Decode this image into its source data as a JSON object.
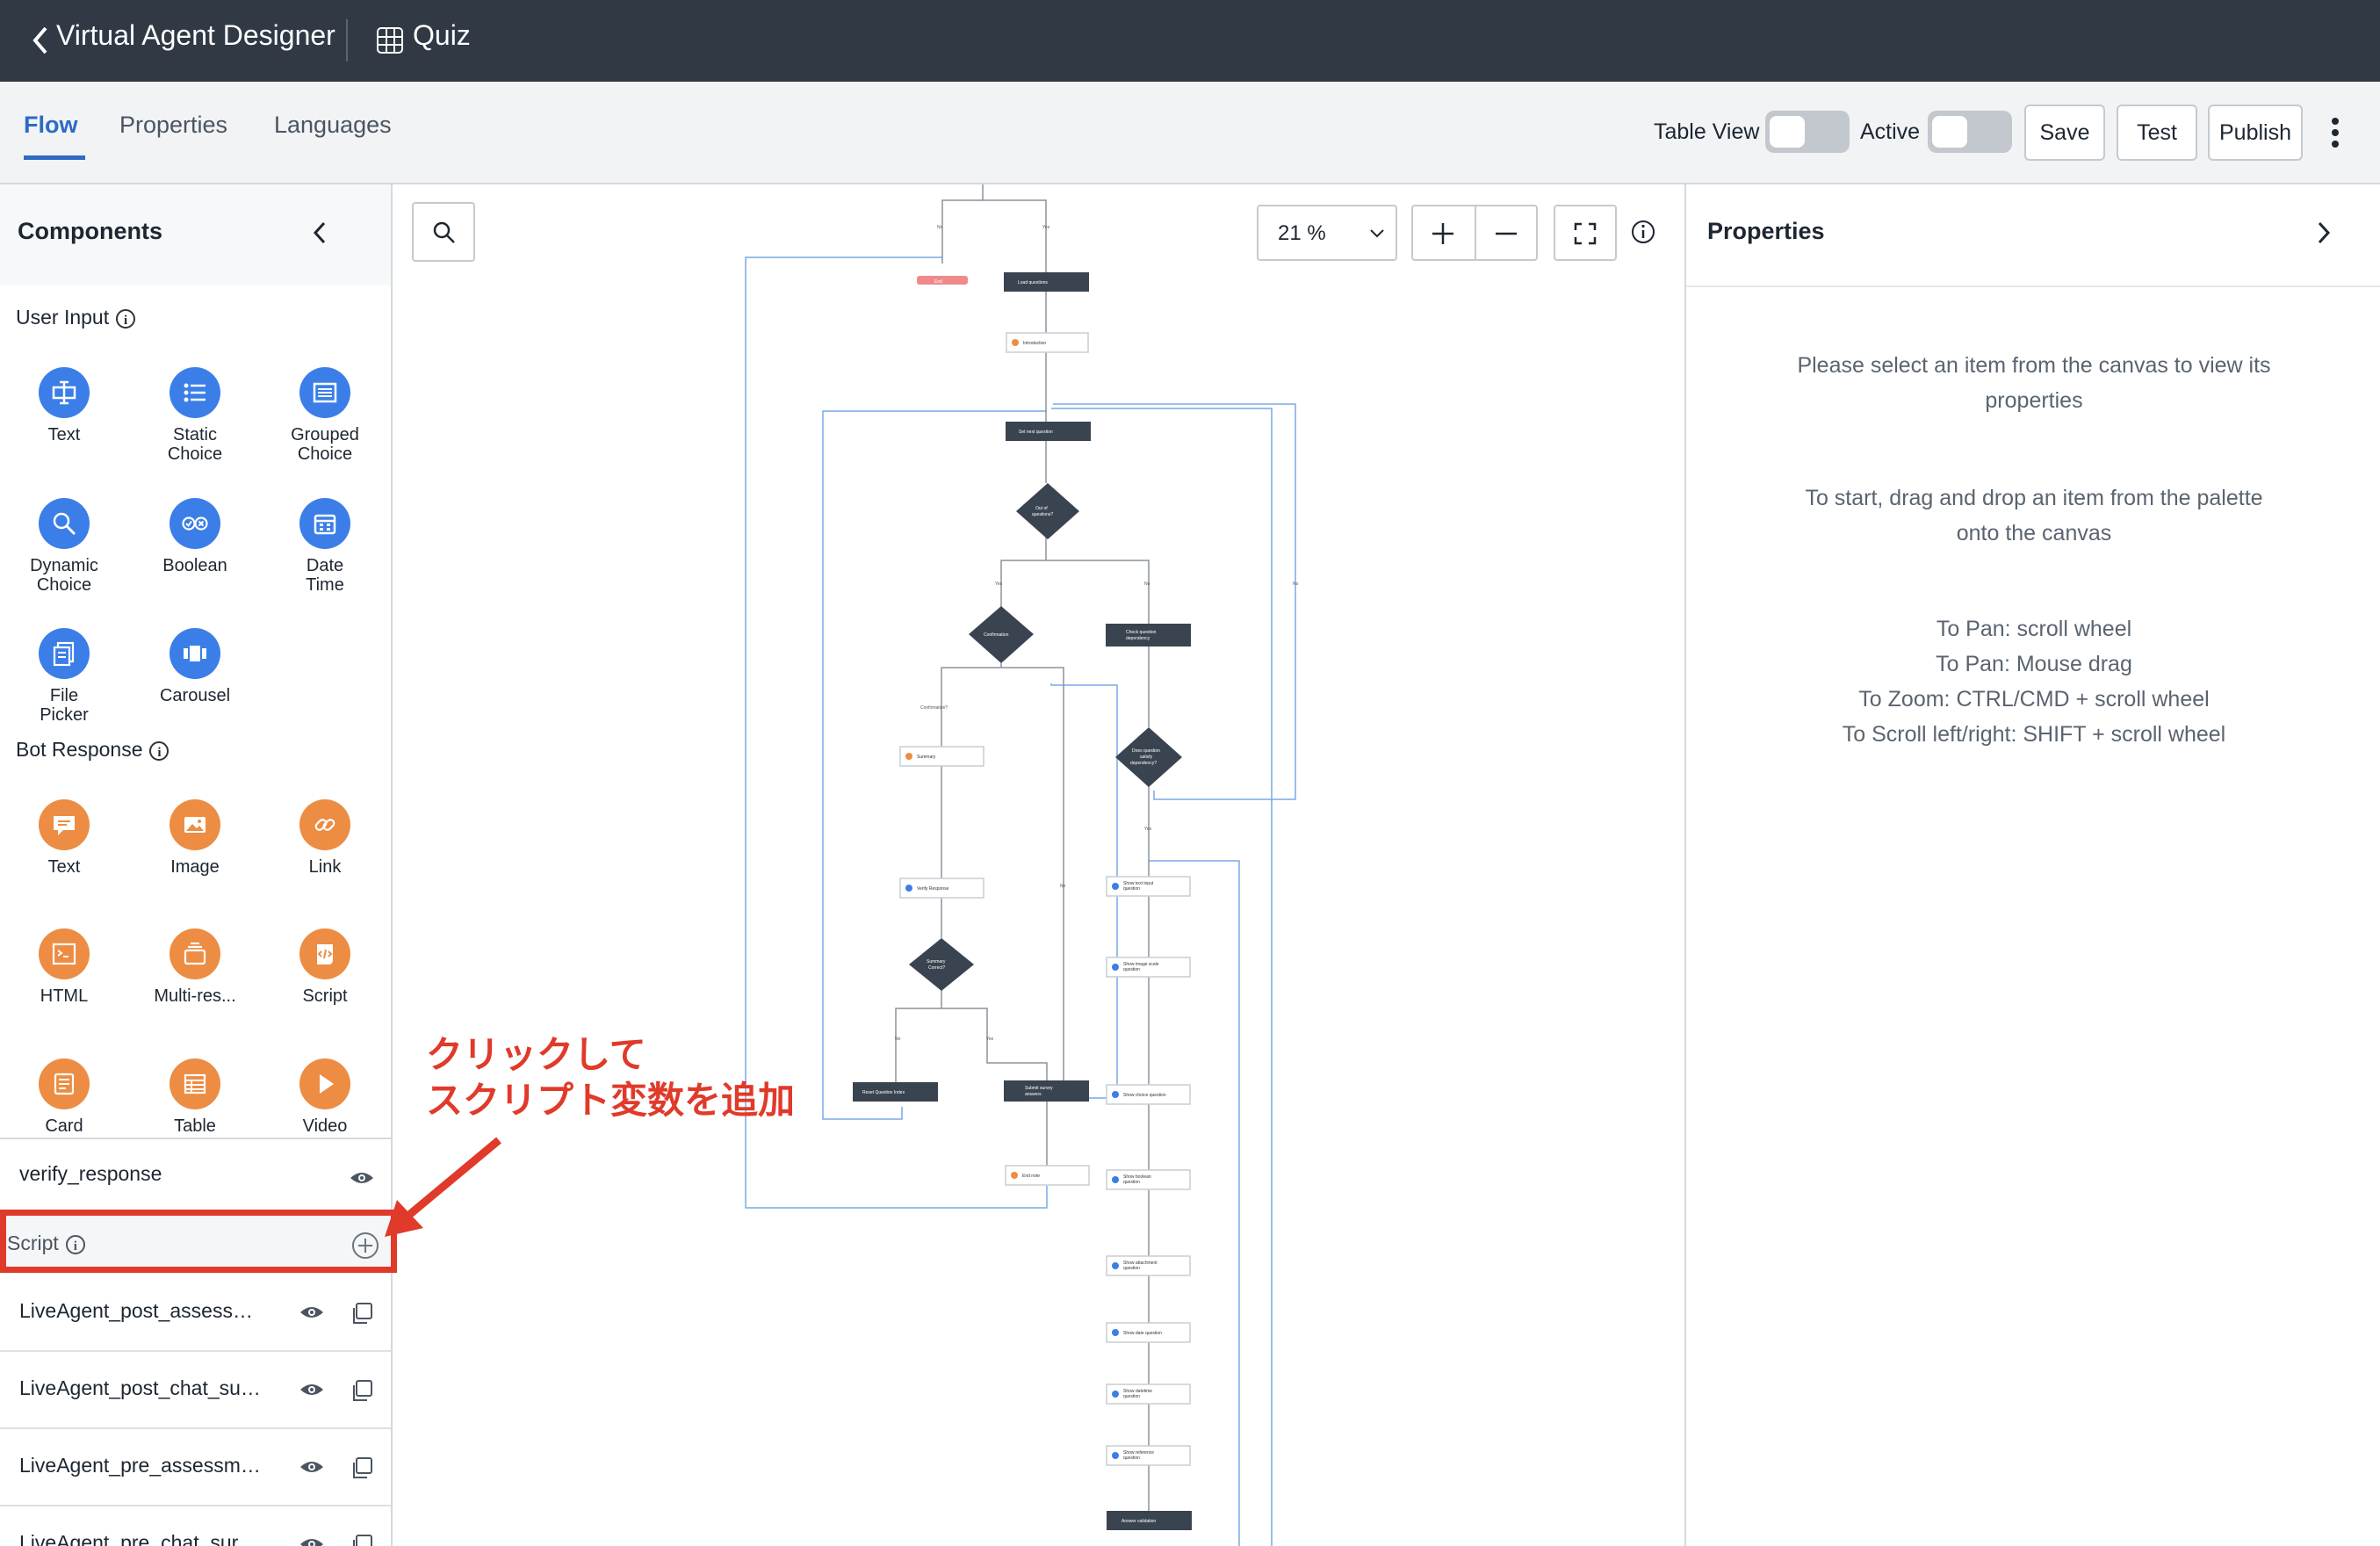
{
  "header": {
    "back_title": "Virtual Agent Designer",
    "topic": "Quiz"
  },
  "tabs": [
    {
      "label": "Flow",
      "active": true
    },
    {
      "label": "Properties",
      "active": false
    },
    {
      "label": "Languages",
      "active": false
    }
  ],
  "toolbar": {
    "table_view_label": "Table View",
    "table_view_on": false,
    "active_label": "Active",
    "active_on": false,
    "save_label": "Save",
    "test_label": "Test",
    "publish_label": "Publish"
  },
  "components": {
    "title": "Components",
    "user_input_label": "User Input",
    "bot_response_label": "Bot Response",
    "user_input": [
      {
        "line1": "Text",
        "line2": "",
        "icon": "text-input-icon"
      },
      {
        "line1": "Static",
        "line2": "Choice",
        "icon": "list-icon"
      },
      {
        "line1": "Grouped",
        "line2": "Choice",
        "icon": "grouped-list-icon"
      },
      {
        "line1": "Dynamic",
        "line2": "Choice",
        "icon": "search-icon"
      },
      {
        "line1": "Boolean",
        "line2": "",
        "icon": "boolean-icon"
      },
      {
        "line1": "Date",
        "line2": "Time",
        "icon": "calendar-icon"
      },
      {
        "line1": "File",
        "line2": "Picker",
        "icon": "file-icon"
      },
      {
        "line1": "Carousel",
        "line2": "",
        "icon": "carousel-icon"
      }
    ],
    "bot_response": [
      {
        "line1": "Text",
        "icon": "message-icon"
      },
      {
        "line1": "Image",
        "icon": "image-icon"
      },
      {
        "line1": "Link",
        "icon": "link-icon"
      },
      {
        "line1": "HTML",
        "icon": "html-icon"
      },
      {
        "line1": "Multi-res...",
        "icon": "multi-response-icon"
      },
      {
        "line1": "Script",
        "icon": "script-icon"
      },
      {
        "line1": "Card",
        "icon": "card-icon"
      },
      {
        "line1": "Table",
        "icon": "table-icon"
      },
      {
        "line1": "Video",
        "icon": "play-icon"
      }
    ]
  },
  "variables": {
    "top_item": "verify_response",
    "script_section_label": "Script",
    "script_items": [
      "LiveAgent_post_assess…",
      "LiveAgent_post_chat_su…",
      "LiveAgent_pre_assessm…",
      "LiveAgent_pre_chat_sur…"
    ]
  },
  "canvas": {
    "zoom_label": "21 %",
    "nodes": {
      "end": "End",
      "load_questions": "Load questions",
      "introduction": "Introduction",
      "set_next_question": "Set next question",
      "out_of_questions_1": "Out of",
      "out_of_questions_2": "questions?",
      "confirmation": "Confirmation",
      "check_dependency_1": "Check question",
      "check_dependency_2": "dependency",
      "summary": "Summary",
      "does_question_1": "Does question",
      "does_question_2": "satisfy",
      "does_question_3": "dependency?",
      "verify_response": "Verify Response",
      "summary_correct_1": "Summary",
      "summary_correct_2": "Correct?",
      "reset_question_index": "Reset Question Index",
      "submit_survey_1": "Submit survey",
      "submit_survey_2": "answers",
      "end_note": "End note",
      "show_text_input_1": "Show text input",
      "show_text_input_2": "question",
      "show_image_scale_1": "Show image scale",
      "show_image_scale_2": "question",
      "show_choice": "Show choice question",
      "show_boolean_1": "Show boolean",
      "show_boolean_2": "question",
      "show_attachment_1": "Show attachment",
      "show_attachment_2": "question",
      "show_date": "Show date question",
      "show_datetime_1": "Show datetime",
      "show_datetime_2": "question",
      "show_reference_1": "Show reference",
      "show_reference_2": "question",
      "answer_validation": "Answer validation"
    },
    "edges": {
      "no": "No",
      "yes": "Yes",
      "confirmation_q": "Confirmation?"
    }
  },
  "properties_panel": {
    "title": "Properties",
    "hint1_line1": "Please select an item from the canvas to view its",
    "hint1_line2": "properties",
    "hint2_line1": "To start, drag and drop an item from the palette",
    "hint2_line2": "onto the canvas",
    "hint3_line1": "To Pan: scroll wheel",
    "hint3_line2": "To Pan: Mouse drag",
    "hint3_line3": "To Zoom: CTRL/CMD + scroll wheel",
    "hint3_line4": "To Scroll left/right: SHIFT + scroll wheel"
  },
  "annotation": {
    "line1": "クリックして",
    "line2": "スクリプト変数を追加",
    "color": "#e03a2a"
  }
}
